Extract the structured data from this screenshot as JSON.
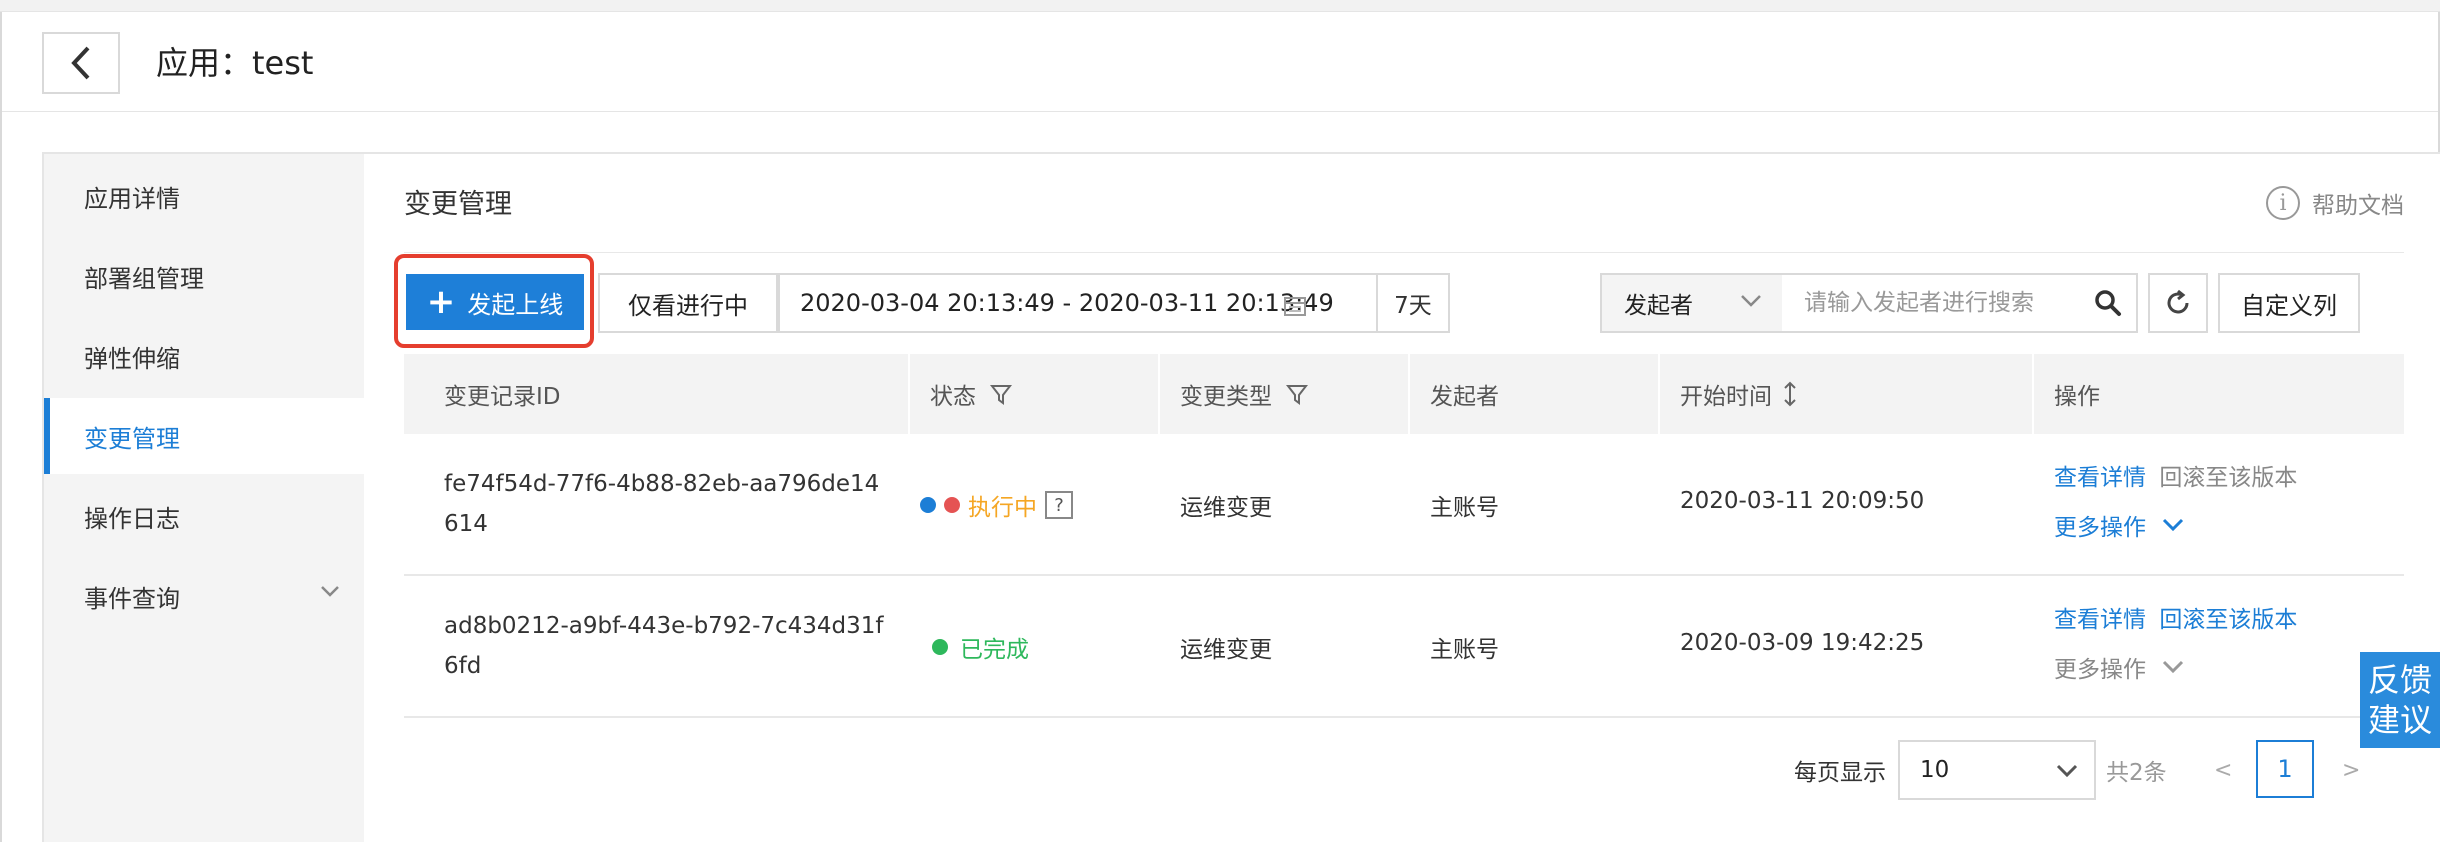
{
  "header": {
    "title": "应用：test"
  },
  "sidebar": {
    "items": [
      {
        "label": "应用详情"
      },
      {
        "label": "部署组管理"
      },
      {
        "label": "弹性伸缩"
      },
      {
        "label": "变更管理"
      },
      {
        "label": "操作日志"
      },
      {
        "label": "事件查询"
      }
    ],
    "active_index": 3
  },
  "main": {
    "title": "变更管理",
    "help_label": "帮助文档"
  },
  "toolbar": {
    "launch_label": "发起上线",
    "running_only_label": "仅看进行中",
    "date_range": "2020-03-04 20:13:49 - 2020-03-11 20:13:49",
    "days_label": "7天",
    "search_field": "发起者",
    "search_placeholder": "请输入发起者进行搜索",
    "custom_columns_label": "自定义列"
  },
  "table": {
    "headers": [
      "变更记录ID",
      "状态",
      "变更类型",
      "发起者",
      "开始时间",
      "操作"
    ],
    "rows": [
      {
        "id": "fe74f54d-77f6-4b88-82eb-aa796de14614",
        "status": "执行中",
        "status_color": "#f5a623",
        "status_help": "?",
        "type": "运维变更",
        "initiator": "主账号",
        "start_time": "2020-03-11 20:09:50",
        "action_detail": "查看详情",
        "action_rollback": "回滚至该版本",
        "action_more": "更多操作"
      },
      {
        "id": "ad8b0212-a9bf-443e-b792-7c434d31f6fd",
        "status": "已完成",
        "status_color": "#2eb85c",
        "type": "运维变更",
        "initiator": "主账号",
        "start_time": "2020-03-09 19:42:25",
        "action_detail": "查看详情",
        "action_rollback": "回滚至该版本",
        "action_more": "更多操作"
      }
    ]
  },
  "pagination": {
    "page_size_label": "每页显示",
    "page_size": "10",
    "total": "共2条",
    "prev": "<",
    "current_page": "1",
    "next": ">"
  },
  "feedback": {
    "line1": "反馈",
    "line2": "建议"
  },
  "colors": {
    "accent": "#1c7ed6",
    "primary_button": "#1e7fd8",
    "highlight_border": "#e53e2e"
  }
}
